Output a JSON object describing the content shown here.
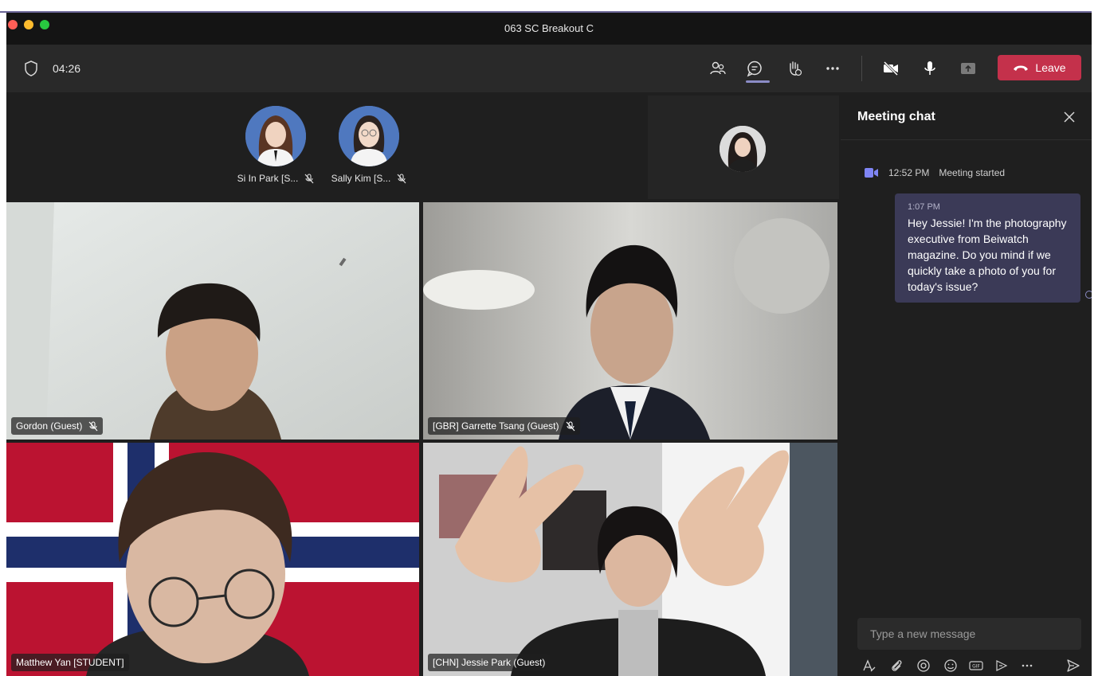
{
  "window": {
    "title": "063 SC Breakout C"
  },
  "toolbar": {
    "timer": "04:26",
    "leave_label": "Leave",
    "icons": [
      "shield-icon",
      "participants-icon",
      "chat-icon",
      "raise-hand-icon",
      "more-icon",
      "camera-off-icon",
      "microphone-icon",
      "share-tray-icon",
      "phone-hangup-icon"
    ]
  },
  "participants_row": [
    {
      "label": "Si In Park [S...",
      "muted": true
    },
    {
      "label": "Sally Kim [S...",
      "muted": true
    }
  ],
  "tiles": [
    {
      "name": "Gordon (Guest)",
      "muted": true
    },
    {
      "name": "[GBR] Garrette Tsang (Guest)",
      "muted": true
    },
    {
      "name": "Matthew Yan [STUDENT]",
      "muted": false
    },
    {
      "name": "[CHN] Jessie Park (Guest)",
      "muted": false
    }
  ],
  "chat": {
    "title": "Meeting chat",
    "system": {
      "time": "12:52 PM",
      "text": "Meeting started"
    },
    "messages": [
      {
        "time": "1:07 PM",
        "text": "Hey Jessie! I'm the photography executive from Beiwatch magazine. Do you mind if we quickly take a photo of you for today's issue?"
      }
    ],
    "composer_placeholder": "Type a new message",
    "composer_tools": [
      "format-icon",
      "attach-icon",
      "loop-icon",
      "emoji-icon",
      "gif-icon",
      "sticker-icon",
      "more-options-icon",
      "send-icon"
    ]
  },
  "colors": {
    "accent": "#8b8cc7",
    "leave": "#c4314b",
    "bubble": "#3b3a57",
    "background": "#1f1f1f"
  }
}
